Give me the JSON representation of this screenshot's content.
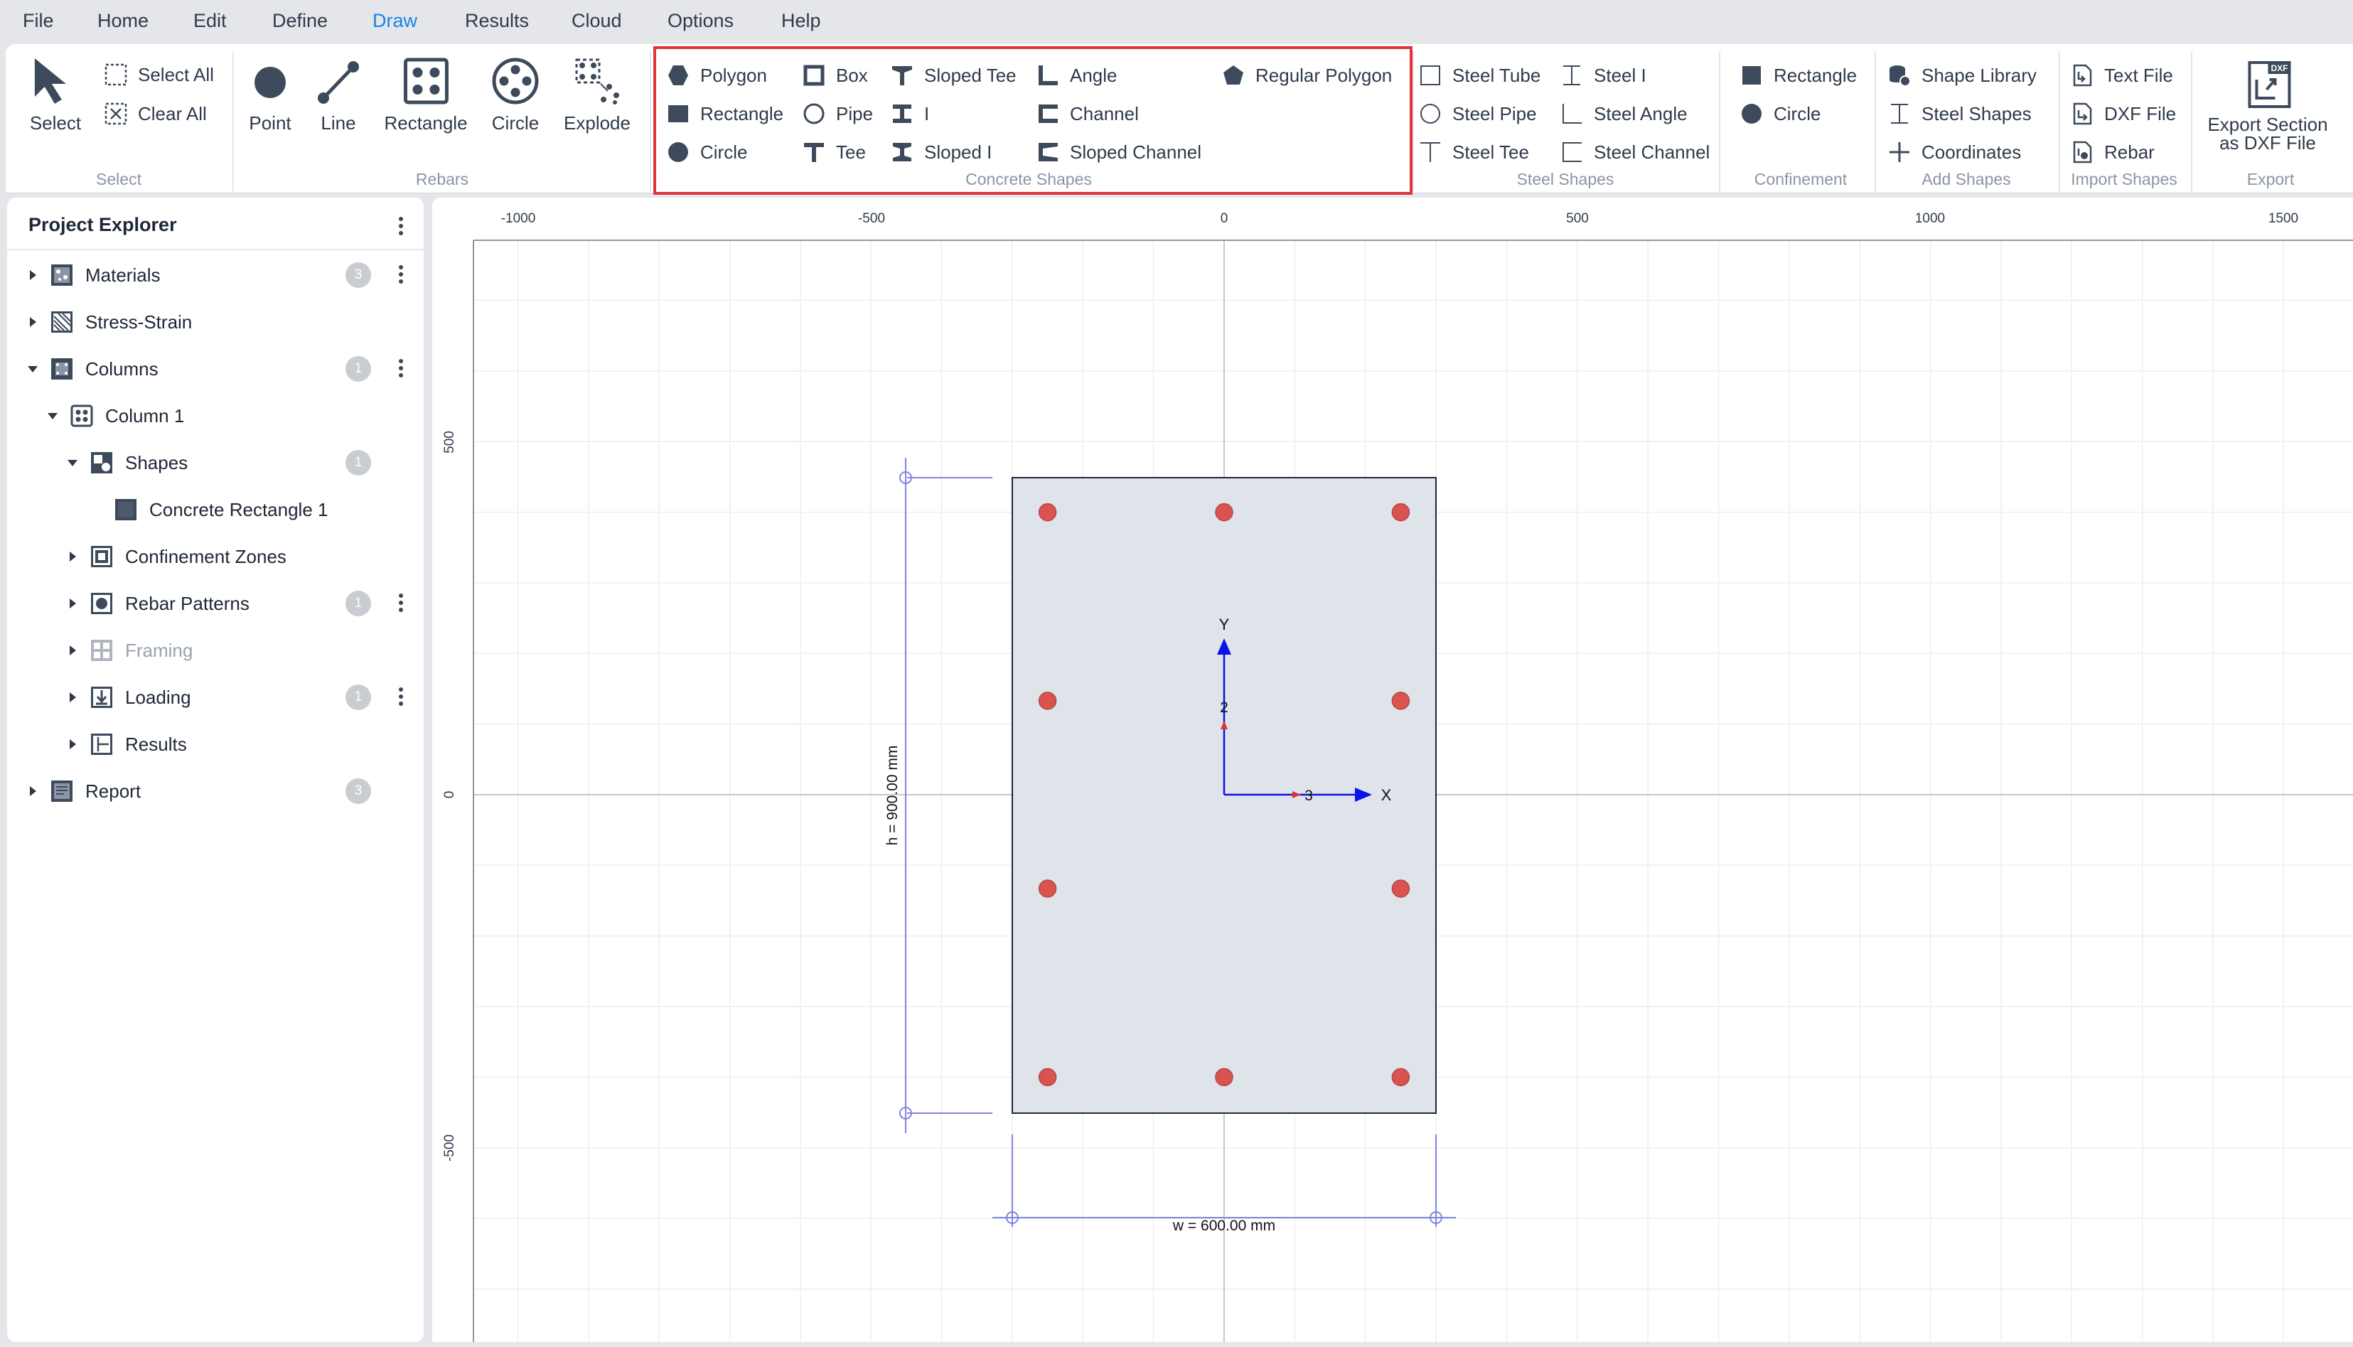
{
  "menu": [
    "File",
    "Home",
    "Edit",
    "Define",
    "Draw",
    "Results",
    "Cloud",
    "Options",
    "Help"
  ],
  "menu_active": "Draw",
  "ribbon": {
    "select": {
      "label": "Select",
      "select_all": "Select All",
      "clear_all": "Clear All",
      "group": "Select"
    },
    "rebars": {
      "point": "Point",
      "line": "Line",
      "rectangle": "Rectangle",
      "circle": "Circle",
      "explode": "Explode",
      "group": "Rebars"
    },
    "concrete": {
      "polygon": "Polygon",
      "rectangle": "Rectangle",
      "circle": "Circle",
      "box": "Box",
      "pipe": "Pipe",
      "tee": "Tee",
      "sloped_tee": "Sloped Tee",
      "i": "I",
      "sloped_i": "Sloped I",
      "angle": "Angle",
      "channel": "Channel",
      "sloped_channel": "Sloped Channel",
      "regular_polygon": "Regular Polygon",
      "group": "Concrete Shapes"
    },
    "steel": {
      "tube": "Steel Tube",
      "pipe": "Steel Pipe",
      "tee": "Steel Tee",
      "i": "Steel I",
      "angle": "Steel Angle",
      "channel": "Steel Channel",
      "group": "Steel Shapes"
    },
    "confinement": {
      "rectangle": "Rectangle",
      "circle": "Circle",
      "group": "Confinement"
    },
    "add_shapes": {
      "library": "Shape Library",
      "steel_shapes": "Steel Shapes",
      "coordinates": "Coordinates",
      "group": "Add Shapes"
    },
    "import_shapes": {
      "text_file": "Text File",
      "dxf_file": "DXF File",
      "rebar": "Rebar",
      "group": "Import Shapes"
    },
    "export": {
      "line1": "Export Section",
      "line2": "as DXF File",
      "group": "Export",
      "dxf_tag": "DXF"
    }
  },
  "explorer": {
    "title": "Project Explorer",
    "items": [
      {
        "label": "Materials",
        "badge": "3"
      },
      {
        "label": "Stress-Strain"
      },
      {
        "label": "Columns",
        "badge": "1"
      },
      {
        "label": "Column 1"
      },
      {
        "label": "Shapes",
        "badge": "1"
      },
      {
        "label": "Concrete Rectangle 1"
      },
      {
        "label": "Confinement Zones"
      },
      {
        "label": "Rebar Patterns",
        "badge": "1"
      },
      {
        "label": "Framing"
      },
      {
        "label": "Loading",
        "badge": "1"
      },
      {
        "label": "Results"
      },
      {
        "label": "Report",
        "badge": "3"
      }
    ]
  },
  "canvas": {
    "x_ticks": [
      "-1000",
      "-500",
      "0",
      "500",
      "1000",
      "1500"
    ],
    "y_ticks": [
      "500",
      "0",
      "-500"
    ],
    "section": {
      "width_mm": 600,
      "height_mm": 900,
      "fill": "#dfe3ea"
    },
    "rebar_positions_mm": [
      [
        -250,
        400
      ],
      [
        0,
        400
      ],
      [
        250,
        400
      ],
      [
        -250,
        133
      ],
      [
        250,
        133
      ],
      [
        -250,
        -133
      ],
      [
        250,
        -133
      ],
      [
        -250,
        -400
      ],
      [
        0,
        -400
      ],
      [
        250,
        -400
      ]
    ],
    "rebar_color": "#d9534f",
    "dim_h": "h = 900.00 mm",
    "dim_w": "w = 600.00 mm",
    "axis_x": "X",
    "axis_y": "Y",
    "local_x": "3",
    "local_y": "2"
  },
  "colors": {
    "accent": "#1b82e6",
    "highlight": "#e0343a",
    "icon": "#3d4a5c",
    "dim_line": "#7f84e0",
    "axis": "#0a13e6"
  }
}
